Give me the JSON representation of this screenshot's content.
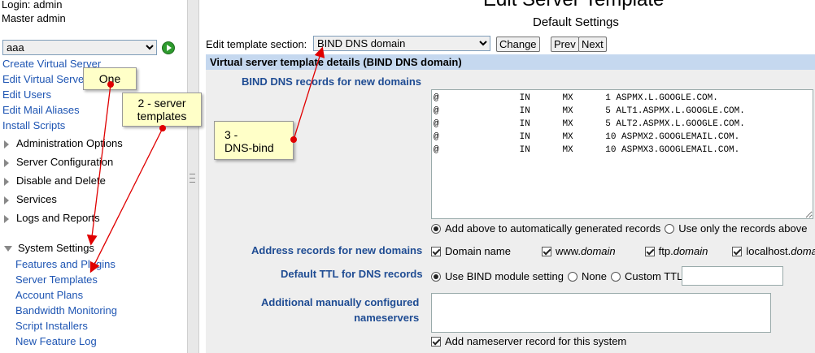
{
  "sidebar": {
    "login": "Login: admin",
    "role": "Master admin",
    "domain_select": "aaa",
    "links": [
      "Create Virtual Server",
      "Edit Virtual Server",
      "Edit Users",
      "Edit Mail Aliases",
      "Install Scripts"
    ],
    "categories": [
      "Administration Options",
      "Server Configuration",
      "Disable and Delete",
      "Services",
      "Logs and Reports"
    ],
    "open_category": "System Settings",
    "sub_items": [
      "Features and Plugins",
      "Server Templates",
      "Account Plans",
      "Bandwidth Monitoring",
      "Script Installers",
      "New Feature Log"
    ]
  },
  "main": {
    "title": "Edit Server Template",
    "subtitle": "Default Settings",
    "section_label": "Edit template section:",
    "section_value": "BIND DNS domain",
    "change_button": "Change",
    "prev_button": "Prev",
    "next_button": "Next",
    "header": "Virtual server template details (BIND DNS domain)",
    "dns_records_label": "BIND DNS records for new domains",
    "dns_records": "@\t\tIN\tMX\t1 ASPMX.L.GOOGLE.COM.\n@\t\tIN\tMX\t5 ALT1.ASPMX.L.GOOGLE.COM.\n@\t\tIN\tMX\t5 ALT2.ASPMX.L.GOOGLE.COM.\n@\t\tIN\tMX\t10 ASPMX2.GOOGLEMAIL.COM.\n@\t\tIN\tMX\t10 ASPMX3.GOOGLEMAIL.COM.",
    "records_mode": [
      "Add above to automatically generated records",
      "Use only the records above"
    ],
    "address_label": "Address records for new domains",
    "address_options": [
      "Domain name",
      "www.",
      "domain",
      "ftp.",
      "domain",
      "localhost.",
      "domain"
    ],
    "ttl_label": "Default TTL for DNS records",
    "ttl_options": [
      "Use BIND module setting",
      "None",
      "Custom TTL"
    ],
    "ns_label_line1": "Additional manually configured",
    "ns_label_line2": "nameservers",
    "ns_checkbox": "Add nameserver record for this system"
  },
  "callouts": {
    "one": "One",
    "two": "2 - server\ntemplates",
    "three": "3 -\nDNS-bind"
  },
  "colors": {
    "link": "#1e55b3",
    "label": "#1f4c93",
    "header_bg": "#c5d8ef",
    "callout_bg": "#ffffc8",
    "arrow": "#e00000"
  }
}
